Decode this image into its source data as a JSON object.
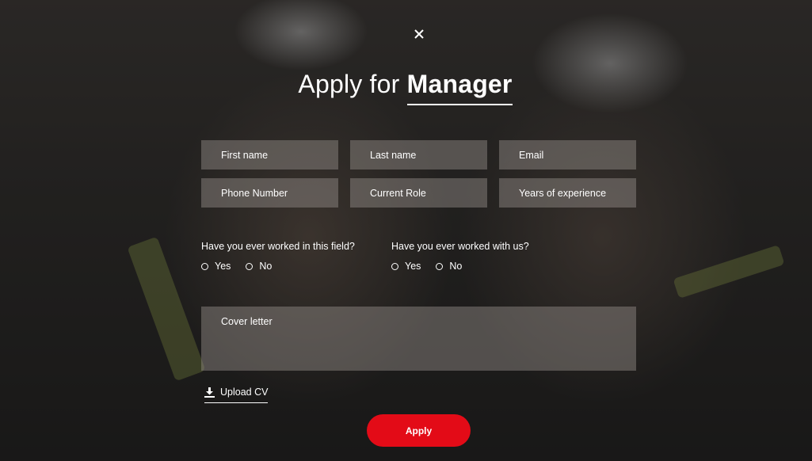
{
  "modal": {
    "title_prefix": "Apply for",
    "title_role": "Manager",
    "close_icon": "close-icon"
  },
  "fields": {
    "first_name": "First name",
    "last_name": "Last name",
    "email": "Email",
    "phone": "Phone Number",
    "current_role": "Current Role",
    "years_experience": "Years of experience"
  },
  "questions": {
    "worked_in_field": {
      "label": "Have you ever worked in this field?",
      "yes": "Yes",
      "no": "No"
    },
    "worked_with_us": {
      "label": "Have you ever worked with us?",
      "yes": "Yes",
      "no": "No"
    }
  },
  "cover_letter": {
    "placeholder": "Cover letter"
  },
  "upload": {
    "label": "Upload CV",
    "icon": "download-icon"
  },
  "apply_button": {
    "label": "Apply"
  },
  "colors": {
    "accent": "#e30b17",
    "field_bg": "#96918c"
  }
}
